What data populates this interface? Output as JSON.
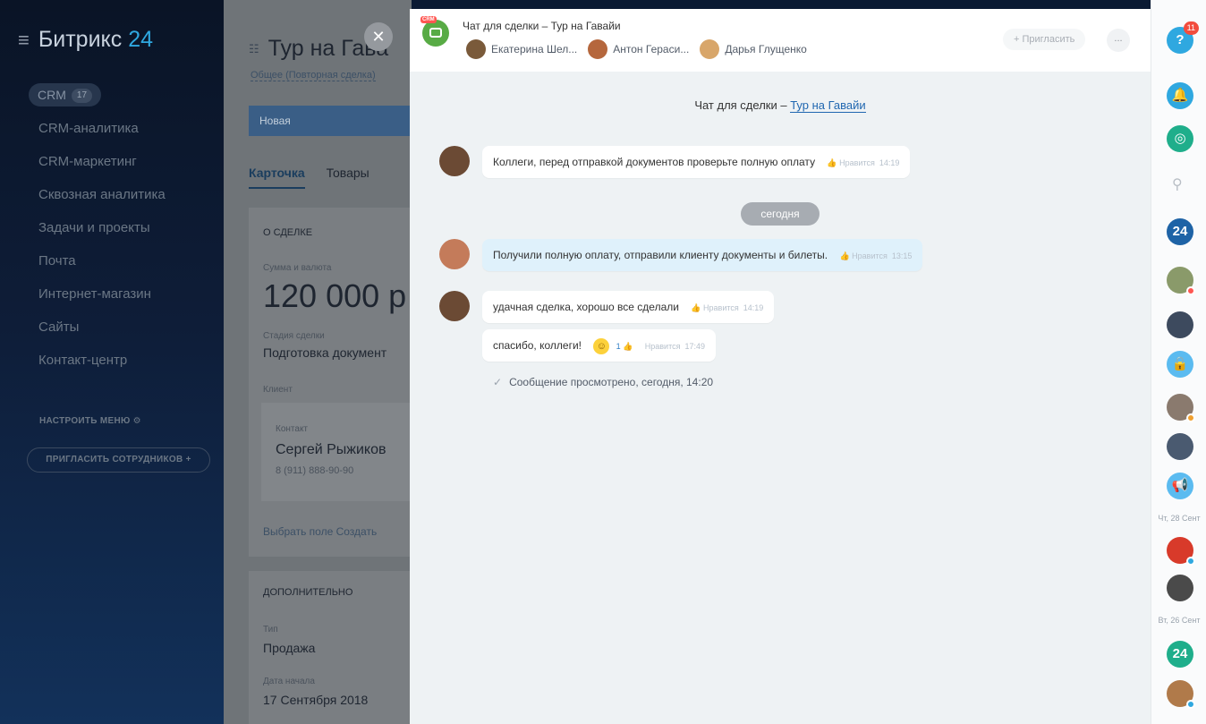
{
  "sidebar": {
    "logo_text": "Битрикс",
    "logo_num": "24",
    "items": [
      {
        "label": "CRM",
        "count": "17"
      },
      {
        "label": "CRM-аналитика"
      },
      {
        "label": "CRM-маркетинг"
      },
      {
        "label": "Сквозная аналитика"
      },
      {
        "label": "Задачи и проекты"
      },
      {
        "label": "Почта"
      },
      {
        "label": "Интернет-магазин"
      },
      {
        "label": "Сайты"
      },
      {
        "label": "Контакт-центр"
      }
    ],
    "settings_label": "НАСТРОИТЬ МЕНЮ ⚙",
    "invite_label": "ПРИГЛАСИТЬ СОТРУДНИКОВ +"
  },
  "deal": {
    "title": "Тур на Гава",
    "breadcrumb": "Общее (Повторная сделка)",
    "stage": "Новая",
    "tabs": [
      "Карточка",
      "Товары"
    ],
    "about_header": "О СДЕЛКЕ",
    "amount_label": "Сумма и валюта",
    "amount_value": "120 000 р",
    "stage_label": "Стадия сделки",
    "stage_value": "Подготовка документ",
    "client_label": "Клиент",
    "contact_label": "Контакт",
    "contact_name": "Сергей Рыжиков",
    "contact_phone": "8 (911) 888-90-90",
    "field_links": "Выбрать поле   Создать",
    "extra_header": "ДОПОЛНИТЕЛЬНО",
    "type_label": "Тип",
    "type_value": "Продажа",
    "date_label": "Дата начала",
    "date_value": "17 Сентября 2018"
  },
  "chat": {
    "crm_tag": "CRM",
    "title": "Чат для сделки – Тур на Гавайи",
    "members": [
      {
        "name": "Екатерина Шел...",
        "color": "#7a5a3a"
      },
      {
        "name": "Антон Гераси...",
        "color": "#b5673d"
      },
      {
        "name": "Дарья Глущенко",
        "color": "#d8a66a"
      }
    ],
    "invite_label": "+ Пригласить",
    "more_label": "...",
    "intro_prefix": "Чат для сделки – ",
    "intro_link": "Тур на Гавайи",
    "date_separator": "сегодня",
    "messages": [
      {
        "text": "Коллеги, перед отправкой документов проверьте полную оплату",
        "like": "Нравится",
        "time": "14:19"
      },
      {
        "text": "Получили полную оплату, отправили клиенту документы и билеты.",
        "like": "Нравится",
        "time": "13:15"
      },
      {
        "text": "удачная сделка, хорошо все сделали",
        "like": "Нравится",
        "time": "14:19"
      },
      {
        "text": "спасибо, коллеги!",
        "reactions": "1",
        "like": "Нравится",
        "time": "17:49"
      }
    ],
    "read_status": "Сообщение просмотрено, сегодня, 14:20"
  },
  "rightbar": {
    "help_badge": "11",
    "item24": "24",
    "date1": "Чт, 28 Сент",
    "date2": "Вт, 26 Сент",
    "item24b": "24",
    "colors": {
      "help": "#2fa8e0",
      "bell": "#2fa8e0",
      "openlines": "#1fae8b",
      "b24": "#1e63a6",
      "lock": "#5bbbf0",
      "announce": "#5bbbf0",
      "b24green": "#1fae8b"
    }
  }
}
